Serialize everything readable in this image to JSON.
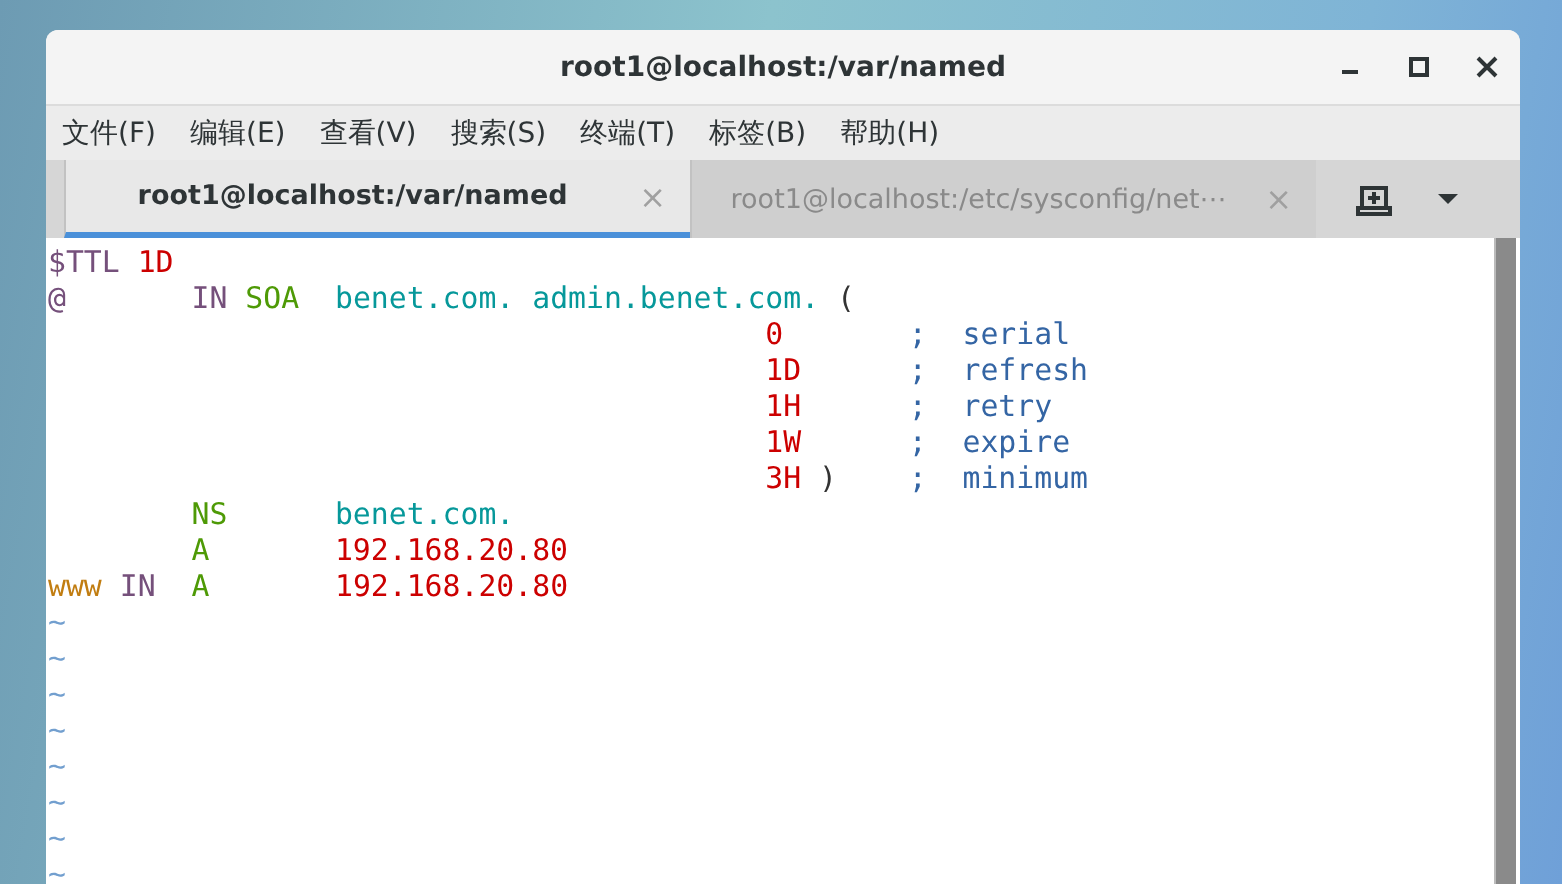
{
  "window": {
    "title": "root1@localhost:/var/named"
  },
  "menu": [
    "文件(F)",
    "编辑(E)",
    "查看(V)",
    "搜索(S)",
    "终端(T)",
    "标签(B)",
    "帮助(H)"
  ],
  "tabs": [
    {
      "label": "root1@localhost:/var/named",
      "selected": true,
      "close": "×"
    },
    {
      "label": "root1@localhost:/etc/sysconfig/net⋯",
      "selected": false,
      "close": "×"
    }
  ],
  "lines": [
    [
      {
        "kind": "directive",
        "text": "$TTL"
      },
      {
        "kind": "number",
        "text": " 1D"
      }
    ],
    [
      {
        "kind": "owner",
        "text": "@"
      },
      {
        "kind": "class",
        "text": "       IN"
      },
      {
        "kind": "type",
        "text": " SOA"
      },
      {
        "kind": "domain",
        "text": "  benet.com."
      },
      {
        "kind": "domain",
        "text": " admin.benet.com."
      },
      {
        "kind": "punct",
        "text": " ("
      }
    ],
    [
      {
        "kind": "number",
        "text": "                                        0"
      },
      {
        "kind": "comment",
        "text": "       ;  serial"
      }
    ],
    [
      {
        "kind": "number",
        "text": "                                        1D"
      },
      {
        "kind": "comment",
        "text": "      ;  refresh"
      }
    ],
    [
      {
        "kind": "number",
        "text": "                                        1H"
      },
      {
        "kind": "comment",
        "text": "      ;  retry"
      }
    ],
    [
      {
        "kind": "number",
        "text": "                                        1W"
      },
      {
        "kind": "comment",
        "text": "      ;  expire"
      }
    ],
    [
      {
        "kind": "number",
        "text": "                                        3H"
      },
      {
        "kind": "punct",
        "text": " )"
      },
      {
        "kind": "comment",
        "text": "    ;  minimum"
      }
    ],
    [
      {
        "kind": "type",
        "text": "        NS"
      },
      {
        "kind": "domain",
        "text": "      benet.com."
      }
    ],
    [
      {
        "kind": "type",
        "text": "        A"
      },
      {
        "kind": "number",
        "text": "       192.168.20.80"
      }
    ],
    [
      {
        "kind": "owner2",
        "text": "www"
      },
      {
        "kind": "class",
        "text": " IN"
      },
      {
        "kind": "type",
        "text": "  A"
      },
      {
        "kind": "number",
        "text": "       192.168.20.80"
      }
    ],
    [
      {
        "kind": "tilde",
        "text": "~"
      }
    ],
    [
      {
        "kind": "tilde",
        "text": "~"
      }
    ],
    [
      {
        "kind": "tilde",
        "text": "~"
      }
    ],
    [
      {
        "kind": "tilde",
        "text": "~"
      }
    ],
    [
      {
        "kind": "tilde",
        "text": "~"
      }
    ],
    [
      {
        "kind": "tilde",
        "text": "~"
      }
    ],
    [
      {
        "kind": "tilde",
        "text": "~"
      }
    ],
    [
      {
        "kind": "tilde",
        "text": "~"
      }
    ]
  ]
}
